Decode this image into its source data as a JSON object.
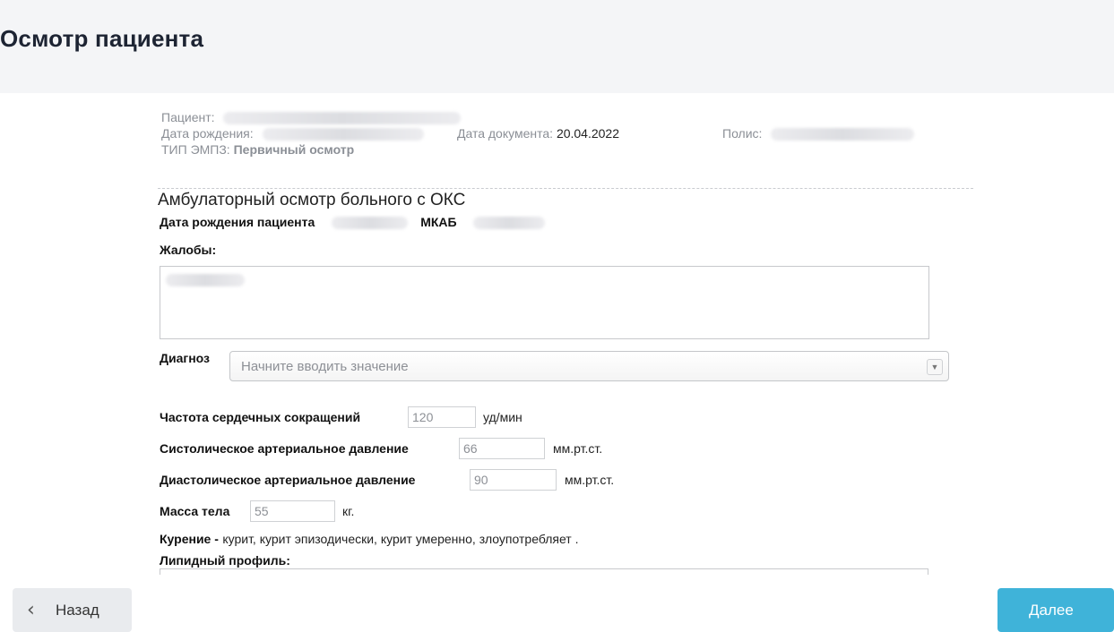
{
  "page": {
    "title": "Осмотр пациента"
  },
  "meta": {
    "patient_label": "Пациент:",
    "birth_label": "Дата рождения:",
    "doc_date_label": "Дата документа:",
    "doc_date_value": "20.04.2022",
    "policy_label": "Полис:",
    "emz_type_label": "ТИП ЭМПЗ:",
    "emz_type_value": "Первичный осмотр"
  },
  "form": {
    "title": "Амбулаторный осмотр больного с ОКС",
    "birth_label": "Дата рождения пациента",
    "mkab_label": "МКАБ",
    "complaints_label": "Жалобы:",
    "diagnosis_label": "Диагноз",
    "diagnosis_placeholder": "Начните вводить значение",
    "heart_rate_label": "Частота сердечных сокращений",
    "heart_rate_value": "120",
    "heart_rate_unit": "уд/мин",
    "systolic_label": "Систолическое артериальное давление",
    "systolic_value": "66",
    "systolic_unit": "мм.рт.ст.",
    "diastolic_label": "Диастолическое артериальное давление",
    "diastolic_value": "90",
    "diastolic_unit": "мм.рт.ст.",
    "weight_label": "Масса тела",
    "weight_value": "55",
    "weight_unit": "кг.",
    "smoking_label": "Курение -",
    "smoking_value": "курит, курит эпизодически, курит умеренно, злоупотребляет .",
    "lipid_label": "Липидный профиль:"
  },
  "footer": {
    "back_label": "Назад",
    "next_label": "Далее",
    "back_icon": "chevron-left-icon"
  },
  "colors": {
    "primary": "#3fb3d9",
    "header_bg": "#f4f5f7",
    "back_button_bg": "#e9ebee"
  }
}
